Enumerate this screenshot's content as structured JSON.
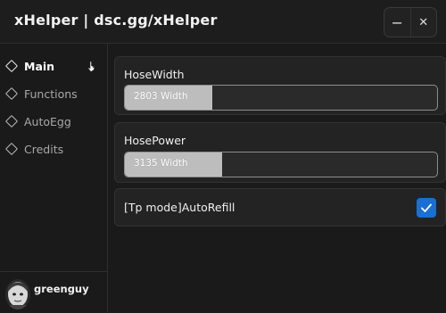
{
  "window": {
    "title": "xHelper | dsc.gg/xHelper",
    "minimize_glyph": "−",
    "close_glyph": "✕"
  },
  "sidebar": {
    "items": [
      {
        "label": "Main",
        "active": true,
        "icon": "diamond-icon"
      },
      {
        "label": "Functions",
        "active": false,
        "icon": "diamond-icon"
      },
      {
        "label": "AutoEgg",
        "active": false,
        "icon": "diamond-icon"
      },
      {
        "label": "Credits",
        "active": false,
        "icon": "diamond-icon"
      }
    ],
    "user": {
      "name": "greenguy",
      "avatar_icon": "avatar-icon"
    }
  },
  "main": {
    "hose_width": {
      "label": "HoseWidth",
      "value_text": "2803 Width",
      "fill_fraction": 0.28
    },
    "hose_power": {
      "label": "HosePower",
      "value_text": "3135 Width",
      "fill_fraction": 0.31
    },
    "auto_refill": {
      "label": "[Tp mode]AutoRefill",
      "checked": true
    }
  },
  "colors": {
    "accent": "#1a6fd0",
    "background": "#1b1b1b",
    "card": "#232323",
    "slider_fill": "#bdbdbd"
  }
}
